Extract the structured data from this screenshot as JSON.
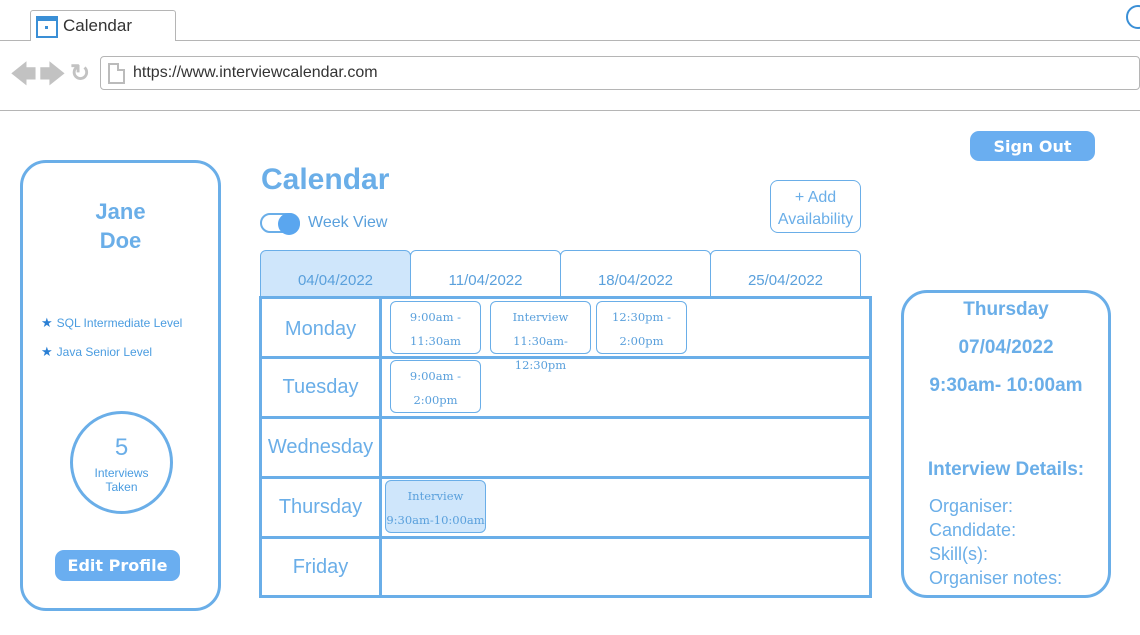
{
  "browser": {
    "tab_title": "Calendar",
    "url": "https://www.interviewcalendar.com"
  },
  "header": {
    "sign_out": "Sign Out",
    "title": "Calendar",
    "week_view_label": "Week View",
    "week_view_on": true,
    "add_availability": [
      "+ Add",
      "Availability"
    ]
  },
  "profile": {
    "first_name": "Jane",
    "last_name": "Doe",
    "skills": [
      "SQL Intermediate Level",
      "Java Senior Level"
    ],
    "interviews_count": "5",
    "interviews_label": [
      "Interviews",
      "Taken"
    ],
    "edit_profile": "Edit Profile"
  },
  "weeks": [
    "04/04/2022",
    "11/04/2022",
    "18/04/2022",
    "25/04/2022"
  ],
  "active_week": 0,
  "days": [
    {
      "name": "Monday",
      "events": [
        {
          "line1": "9:00am -",
          "line2": "11:30am"
        },
        {
          "line1": "Interview",
          "line2": "11:30am-12:30pm"
        },
        {
          "line1": "12:30pm -",
          "line2": "2:00pm"
        }
      ]
    },
    {
      "name": "Tuesday",
      "events": [
        {
          "line1": "9:00am -",
          "line2": "2:00pm"
        }
      ]
    },
    {
      "name": "Wednesday",
      "events": []
    },
    {
      "name": "Thursday",
      "events": [
        {
          "line1": "Interview",
          "line2": "9:30am-10:00am",
          "selected": true
        }
      ]
    },
    {
      "name": "Friday",
      "events": []
    }
  ],
  "detail": {
    "day": "Thursday",
    "date": "07/04/2022",
    "time": "9:30am- 10:00am",
    "section_title": "Interview Details:",
    "fields": [
      "Organiser:",
      "Candidate:",
      "Skill(s):",
      "Organiser notes:"
    ]
  },
  "colors": {
    "accent": "#6aaee8",
    "button": "#6aaef0",
    "selected_bg": "#cfe6fb"
  }
}
